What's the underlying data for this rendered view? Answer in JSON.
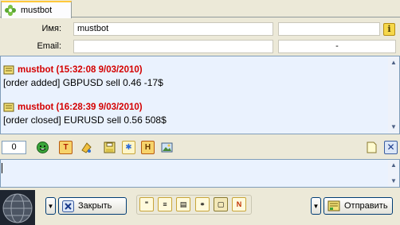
{
  "tab": {
    "label": "mustbot",
    "icon": "flower-icon"
  },
  "info": {
    "name_label": "Имя:",
    "name_value": "mustbot",
    "email_label": "Email:",
    "email_value": "",
    "field_right_top": "",
    "field_right_bottom": "-"
  },
  "messages": [
    {
      "sender": "mustbot (15:32:08 9/03/2010)",
      "text": "[order added] GBPUSD  sell 0.46  -17$"
    },
    {
      "sender": "mustbot (16:28:39 9/03/2010)",
      "text": "[order closed] EURUSD  sell 0.56  508$"
    }
  ],
  "toolbar": {
    "count": "0",
    "icons": [
      "smiley-icon",
      "text-t-icon",
      "paint-icon",
      "save-icon",
      "star-icon",
      "h-icon",
      "image-icon",
      "note-icon",
      "close-icon"
    ]
  },
  "input": {
    "value": ""
  },
  "bottom": {
    "close_label": "Закрыть",
    "send_label": "Отправить",
    "mini_icons": [
      "quote-icon",
      "list-icon",
      "doc-icon",
      "link-icon",
      "note-icon",
      "n-icon"
    ]
  },
  "colors": {
    "sender": "#d40000",
    "log_bg": "#eaf2fe",
    "border": "#7f9db9",
    "window_bg": "#ece9d8"
  }
}
